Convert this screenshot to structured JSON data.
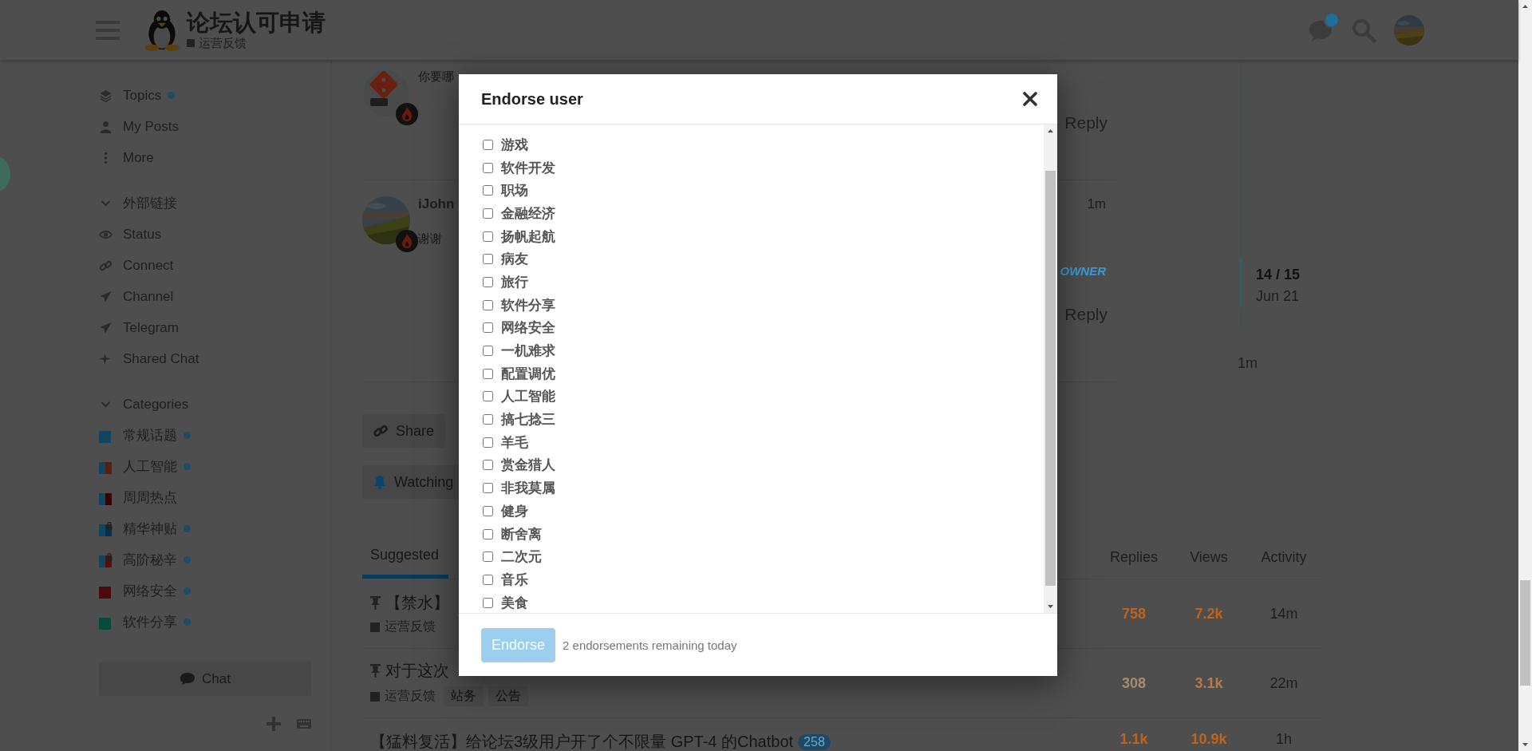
{
  "header": {
    "title": "论坛认可申请",
    "category": "运营反馈",
    "notification": true
  },
  "sidebar": {
    "nav": [
      {
        "label": "Topics",
        "unread": true
      },
      {
        "label": "My Posts",
        "unread": false
      },
      {
        "label": "More",
        "unread": false
      }
    ],
    "links_section": {
      "title": "外部链接",
      "expanded": true,
      "links": [
        {
          "label": "Status"
        },
        {
          "label": "Connect"
        },
        {
          "label": "Channel"
        },
        {
          "label": "Telegram"
        },
        {
          "label": "Shared Chat"
        }
      ]
    },
    "categories": {
      "title": "Categories",
      "expanded": true,
      "items": [
        {
          "label": "常规话题",
          "swatch": [
            {
              "color": "#114660"
            }
          ],
          "locked": false,
          "unread": true
        },
        {
          "label": "人工智能",
          "swatch": [
            {
              "color": "#114660"
            },
            {
              "color": "#5a1e10"
            }
          ],
          "locked": false,
          "unread": true
        },
        {
          "label": "周周热点",
          "swatch": [
            {
              "color": "#114660"
            },
            {
              "color": "#3a0000"
            }
          ],
          "locked": false,
          "unread": false
        },
        {
          "label": "精华神贴",
          "swatch": [
            {
              "color": "#114660"
            },
            {
              "color": "#05304f"
            }
          ],
          "locked": true,
          "unread": true
        },
        {
          "label": "高阶秘辛",
          "swatch": [
            {
              "color": "#114660"
            },
            {
              "color": "#5a0e05"
            }
          ],
          "locked": true,
          "unread": true
        },
        {
          "label": "网络安全",
          "swatch": [
            {
              "color": "#4a0a10"
            }
          ],
          "locked": false,
          "unread": true
        },
        {
          "label": "软件分享",
          "swatch": [
            {
              "color": "#0a4a3c"
            }
          ],
          "locked": false,
          "unread": true
        }
      ]
    },
    "chat_button": "Chat"
  },
  "posts": [
    {
      "kind": "logo",
      "text": "你要哪",
      "action": "Reply"
    },
    {
      "author": "iJohn",
      "age": "1m",
      "text": "谢谢",
      "flair": "OWNER",
      "action": "Reply"
    }
  ],
  "timeline": {
    "position": "14 / 15",
    "date": "Jun 21",
    "last": "1m"
  },
  "topic_buttons": [
    {
      "label": "Share"
    },
    {
      "label": "Watching"
    }
  ],
  "suggested": {
    "tabs": [
      {
        "label": "Suggested",
        "selected": true
      }
    ],
    "columns": [
      "Replies",
      "Views",
      "Activity"
    ],
    "rows": [
      {
        "pinned": true,
        "title": "【禁水】",
        "category": "运营反馈",
        "tags": [],
        "replies": {
          "text": "758",
          "color": "#c0641c"
        },
        "views": {
          "text": "7.2k",
          "color": "#c0641c"
        },
        "activity": "14m"
      },
      {
        "pinned": true,
        "title": "对于这次",
        "category": "运营反馈",
        "tags": [
          "站务",
          "公告"
        ],
        "replies": {
          "text": "308",
          "color": "#a88a6c"
        },
        "views": {
          "text": "3.1k",
          "color": "#b87a44"
        },
        "activity": "22m"
      },
      {
        "pinned": false,
        "title": "【猛料复活】给论坛3级用户开了个不限量 GPT-4 的Chatbot",
        "badge": "258",
        "tags": [],
        "replies": {
          "text": "1.1k",
          "color": "#c0641c"
        },
        "views": {
          "text": "10.9k",
          "color": "#c0641c"
        },
        "activity": "1h"
      }
    ]
  },
  "dialog": {
    "title": "Endorse user",
    "options": [
      {
        "label": "游戏",
        "checked": false
      },
      {
        "label": "软件开发",
        "checked": false
      },
      {
        "label": "职场",
        "checked": false
      },
      {
        "label": "金融经济",
        "checked": false
      },
      {
        "label": "扬帆起航",
        "checked": false
      },
      {
        "label": "病友",
        "checked": false
      },
      {
        "label": "旅行",
        "checked": false
      },
      {
        "label": "软件分享",
        "checked": false
      },
      {
        "label": "网络安全",
        "checked": false
      },
      {
        "label": "一机难求",
        "checked": false
      },
      {
        "label": "配置调优",
        "checked": false
      },
      {
        "label": "人工智能",
        "checked": false
      },
      {
        "label": "搞七捻三",
        "checked": false
      },
      {
        "label": "羊毛",
        "checked": false
      },
      {
        "label": "赏金猎人",
        "checked": false
      },
      {
        "label": "非我莫属",
        "checked": false
      },
      {
        "label": "健身",
        "checked": false
      },
      {
        "label": "断舍离",
        "checked": false
      },
      {
        "label": "二次元",
        "checked": false
      },
      {
        "label": "音乐",
        "checked": false
      },
      {
        "label": "美食",
        "checked": false
      }
    ],
    "submit": {
      "label": "Endorse",
      "disabled": true
    },
    "note": "2 endorsements remaining today"
  }
}
